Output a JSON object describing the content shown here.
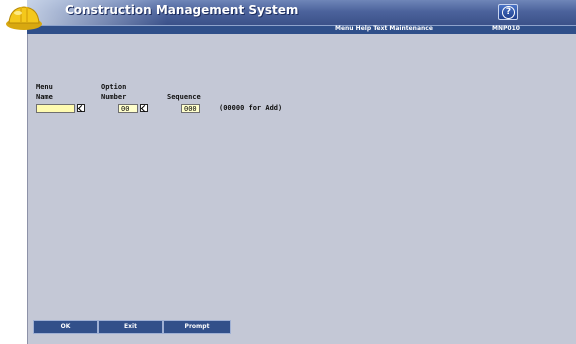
{
  "header": {
    "app_title": "Construction Management System",
    "help_icon": "help-question-icon"
  },
  "subheader": {
    "screen_title": "Menu Help Text Maintenance",
    "program_id": "MNP010"
  },
  "form": {
    "menu_name_label_1": "Menu",
    "menu_name_label_2": "Name",
    "menu_name_value": "",
    "option_label_1": "Option",
    "option_label_2": "Number",
    "option_value": "00",
    "sequence_label": "Sequence",
    "sequence_value": "000",
    "sequence_hint": "(00000 for Add)"
  },
  "function_keys": {
    "ok": "OK",
    "exit": "Exit",
    "prompt": "Prompt"
  },
  "colors": {
    "header": "#4c639c",
    "background": "#c4c8d6",
    "input": "#ffffcc",
    "button": "#32508a"
  }
}
